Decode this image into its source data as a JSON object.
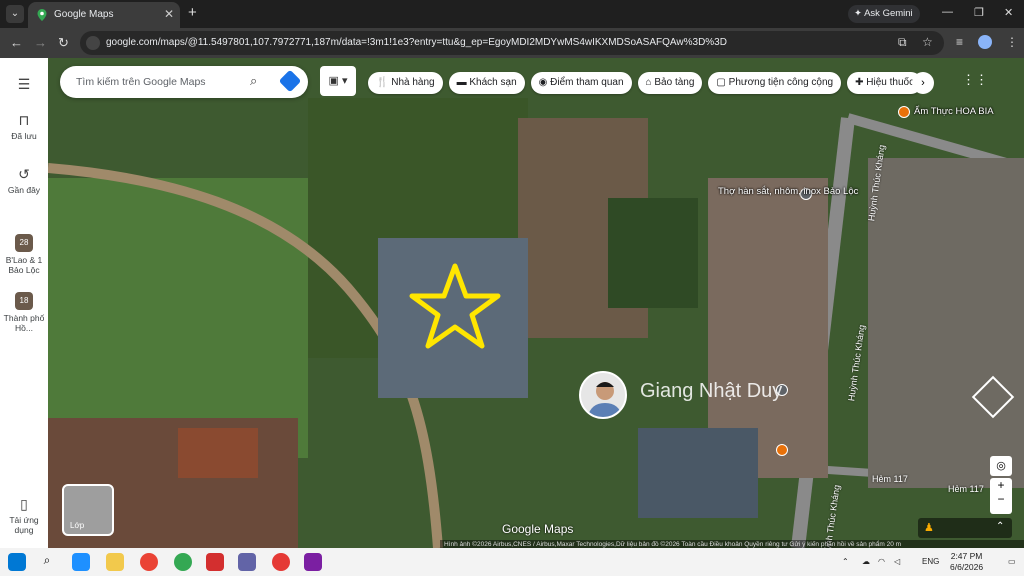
{
  "browser": {
    "tab_title": "Google Maps",
    "ask_gemini": "Ask Gemini",
    "url": "google.com/maps/@11.5497801,107.7972771,187m/data=!3m1!1e3?entry=ttu&g_ep=EgoyMDI2MDYwMS4wIKXMDSoASAFQAw%3D%3D"
  },
  "rail": {
    "menu": "menu",
    "saved_label": "Đã lưu",
    "recent_label": "Gần đây",
    "recent1_label": "B'Lao & 1 Bảo Lộc",
    "recent1_badge": "28",
    "recent2_label": "Thành phố Hồ...",
    "recent2_badge": "18",
    "app_label": "Tải ứng dụng"
  },
  "search": {
    "placeholder": "Tìm kiếm trên Google Maps"
  },
  "chips": [
    "Nhà hàng",
    "Khách sạn",
    "Điểm tham quan",
    "Bảo tàng",
    "Phương tiện công cộng",
    "Hiệu thuốc"
  ],
  "places": {
    "restaurant": "Ẩm Thực HOA BIA",
    "workshop": "Thợ hàn sắt, nhôm, inox Bảo Lộc",
    "street1": "Huỳnh Thúc Kháng",
    "street2": "Huỳnh Thúc Kháng",
    "street3": "Huỳnh Thúc Kháng",
    "alley1": "Hẻm 117",
    "alley2": "Hẻm 117"
  },
  "overlay": {
    "watermark": "Giang Nhật Duy"
  },
  "map": {
    "layers_label": "Lớp",
    "logo": "Google Maps",
    "attribution": "Hình ảnh ©2026 Airbus,CNES / Airbus,Maxar Technologies,Dữ liệu bản đồ ©2026   Toàn cầu   Điều khoản   Quyền riêng tư   Gửi ý kiến phản hồi về sản phẩm   20 m"
  },
  "taskbar": {
    "time": "2:47 PM",
    "date": "6/6/2026",
    "lang": "ENG"
  }
}
